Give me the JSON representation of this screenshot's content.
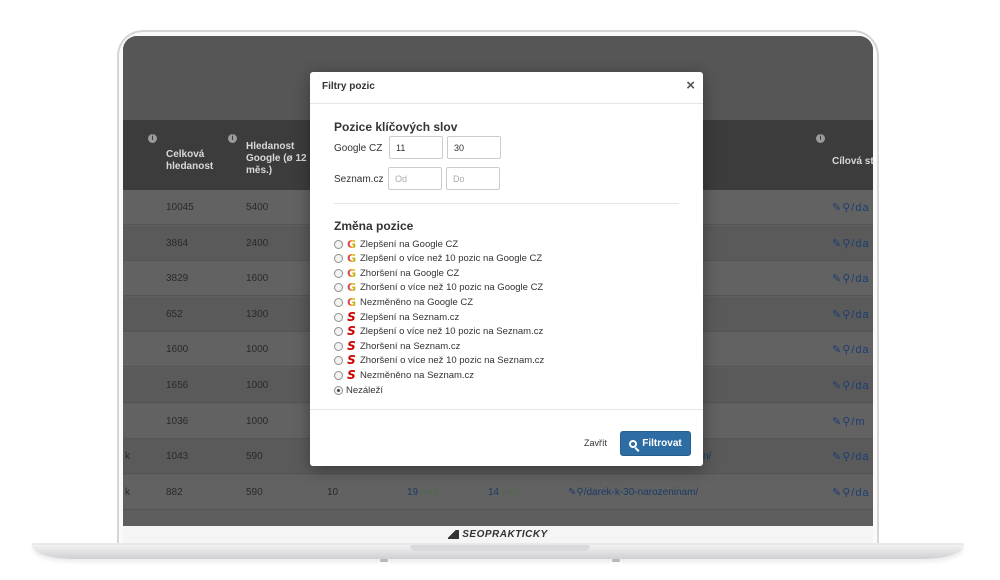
{
  "brand": {
    "name": "SEOPRAKTICKY"
  },
  "table": {
    "headers": [
      {
        "label": "Celková hledanost"
      },
      {
        "label": "Hledanost Google (ø 12 měs.)"
      },
      {
        "label": "Cílová st"
      }
    ],
    "rows": [
      {
        "prefix": "",
        "total": "10045",
        "google": "5400",
        "target": "/da"
      },
      {
        "prefix": "",
        "total": "3864",
        "google": "2400",
        "target": "/da"
      },
      {
        "prefix": "",
        "total": "3829",
        "google": "1600",
        "target": "/da"
      },
      {
        "prefix": "",
        "total": "652",
        "google": "1300",
        "target": "/da"
      },
      {
        "prefix": "",
        "total": "1600",
        "google": "1000",
        "target": "/da"
      },
      {
        "prefix": "",
        "total": "1656",
        "google": "1000",
        "target": "/da"
      },
      {
        "prefix": "",
        "total": "1036",
        "google": "1000",
        "target": "/m"
      },
      {
        "prefix": "k",
        "total": "1043",
        "google": "590",
        "target": "/da",
        "url_tail": "n/"
      },
      {
        "prefix": "k",
        "total": "882",
        "google": "590",
        "col3": "10",
        "pos_google": "19",
        "delta_google": "(+0)",
        "pos_seznam": "14",
        "delta_seznam": "(+0)",
        "url": "/darek-k-30-narozeninam/",
        "target": "/da"
      }
    ]
  },
  "modal": {
    "title": "Filtry pozic",
    "close_glyph": "×",
    "keyword_section": {
      "title": "Pozice klíčových slov",
      "google_label": "Google CZ",
      "google_from": "11",
      "google_to": "30",
      "seznam_label": "Seznam.cz",
      "seznam_from_placeholder": "Od",
      "seznam_to_placeholder": "Do"
    },
    "change_section": {
      "title": "Změna pozice",
      "options": [
        {
          "label": "Zlepšení na Google CZ",
          "icon": "google-icon",
          "checked": false
        },
        {
          "label": "Zlepšení o více než 10 pozic na Google CZ",
          "icon": "google-icon",
          "checked": false
        },
        {
          "label": "Zhoršení na Google CZ",
          "icon": "google-icon",
          "checked": false
        },
        {
          "label": "Zhoršení o více než 10 pozic na Google CZ",
          "icon": "google-icon",
          "checked": false
        },
        {
          "label": "Nezměněno na Google CZ",
          "icon": "google-icon",
          "checked": false
        },
        {
          "label": "Zlepšení na Seznam.cz",
          "icon": "seznam-icon",
          "checked": false
        },
        {
          "label": "Zlepšení o více než 10 pozic na Seznam.cz",
          "icon": "seznam-icon",
          "checked": false
        },
        {
          "label": "Zhoršení na Seznam.cz",
          "icon": "seznam-icon",
          "checked": false
        },
        {
          "label": "Zhoršení o více než 10 pozic na Seznam.cz",
          "icon": "seznam-icon",
          "checked": false
        },
        {
          "label": "Nezměněno na Seznam.cz",
          "icon": "seznam-icon",
          "checked": false
        },
        {
          "label": "Nezáleží",
          "icon": "",
          "checked": true
        }
      ]
    },
    "footer": {
      "close_label": "Zavřít",
      "submit_label": "Filtrovat"
    }
  },
  "colors": {
    "primary": "#2e6da4",
    "google": "#4285f4",
    "seznam": "#cc0000"
  }
}
